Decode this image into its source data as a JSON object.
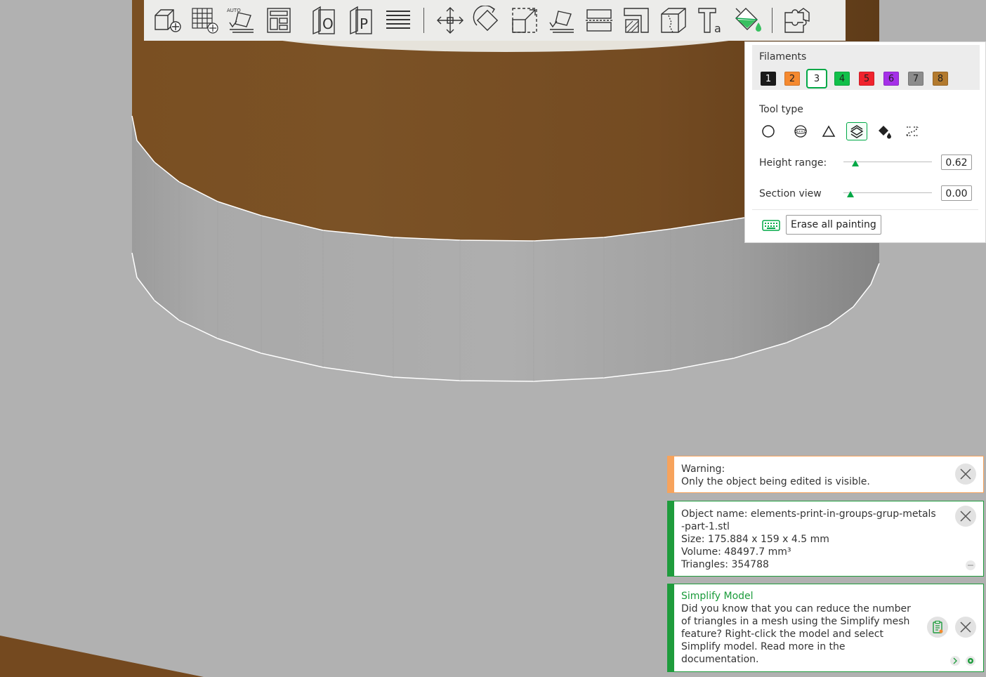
{
  "toolbar": {
    "tools": [
      {
        "name": "add-cube",
        "icon": "cube-plus-icon"
      },
      {
        "name": "add-plate",
        "icon": "grid-plus-icon"
      },
      {
        "name": "auto-orient",
        "icon": "auto-orient-icon",
        "badge": "AUTO"
      },
      {
        "name": "arrange",
        "icon": "arrange-icon"
      },
      {
        "name": "split-objects",
        "icon": "split-objects-icon",
        "letter": "O"
      },
      {
        "name": "split-parts",
        "icon": "split-parts-icon",
        "letter": "P"
      },
      {
        "name": "variable-layer",
        "icon": "layers-icon"
      },
      {
        "name": "move",
        "icon": "move-icon"
      },
      {
        "name": "rotate",
        "icon": "rotate-icon"
      },
      {
        "name": "scale",
        "icon": "scale-icon"
      },
      {
        "name": "lay-on-face",
        "icon": "lay-on-face-icon"
      },
      {
        "name": "cut",
        "icon": "cut-icon"
      },
      {
        "name": "support-paint",
        "icon": "support-paint-icon"
      },
      {
        "name": "seam-paint",
        "icon": "seam-paint-icon"
      },
      {
        "name": "text",
        "icon": "text-icon",
        "letter": "T",
        "sub": "a"
      },
      {
        "name": "color-paint",
        "icon": "color-paint-icon"
      },
      {
        "name": "assembly",
        "icon": "assembly-icon"
      }
    ]
  },
  "paint_panel": {
    "filaments_label": "Filaments",
    "filaments": [
      {
        "label": "1",
        "color": "#1a1a1a",
        "text_color": "#ffffff"
      },
      {
        "label": "2",
        "color": "#f5892f",
        "text_color": "#222222"
      },
      {
        "label": "3",
        "color": "#ffffff",
        "text_color": "#222222",
        "selected": true
      },
      {
        "label": "4",
        "color": "#11c04a",
        "text_color": "#222222"
      },
      {
        "label": "5",
        "color": "#f0232d",
        "text_color": "#222222"
      },
      {
        "label": "6",
        "color": "#a530e8",
        "text_color": "#222222"
      },
      {
        "label": "7",
        "color": "#8c8c8c",
        "text_color": "#222222"
      },
      {
        "label": "8",
        "color": "#b37a2e",
        "text_color": "#222222"
      }
    ],
    "tool_type_label": "Tool type",
    "tool_types": [
      "circle-icon",
      "sphere-icon",
      "triangle-icon",
      "height-range-icon",
      "fill-bucket-icon",
      "gap-fill-icon"
    ],
    "selected_tool": 3,
    "height_range_label": "Height range:",
    "height_range_value": "0.62",
    "height_range_fraction": 0.1,
    "section_view_label": "Section view",
    "section_view_value": "0.00",
    "section_view_fraction": 0.05,
    "erase_label": "Erase all painting"
  },
  "notifications": {
    "warning": {
      "text": "Warning:\nOnly the object being edited is visible."
    },
    "object_info": {
      "text": "Object name: elements-print-in-groups-grup-metals\n-part-1.stl\nSize: 175.884 x 159 x 4.5 mm\nVolume: 48497.7 mm³\nTriangles: 354788"
    },
    "tip": {
      "title": "Simplify Model",
      "text": "Did you know that you can reduce the number\nof triangles in a mesh using the Simplify mesh\nfeature? Right-click the model and select\nSimplify model. Read more in the\ndocumentation."
    }
  },
  "colors": {
    "accent": "#00a846",
    "warning": "#f7a35c",
    "model_painted": "#7a5024",
    "model_unpainted": "#a8a8a8",
    "bed": "#b1b1b1"
  }
}
